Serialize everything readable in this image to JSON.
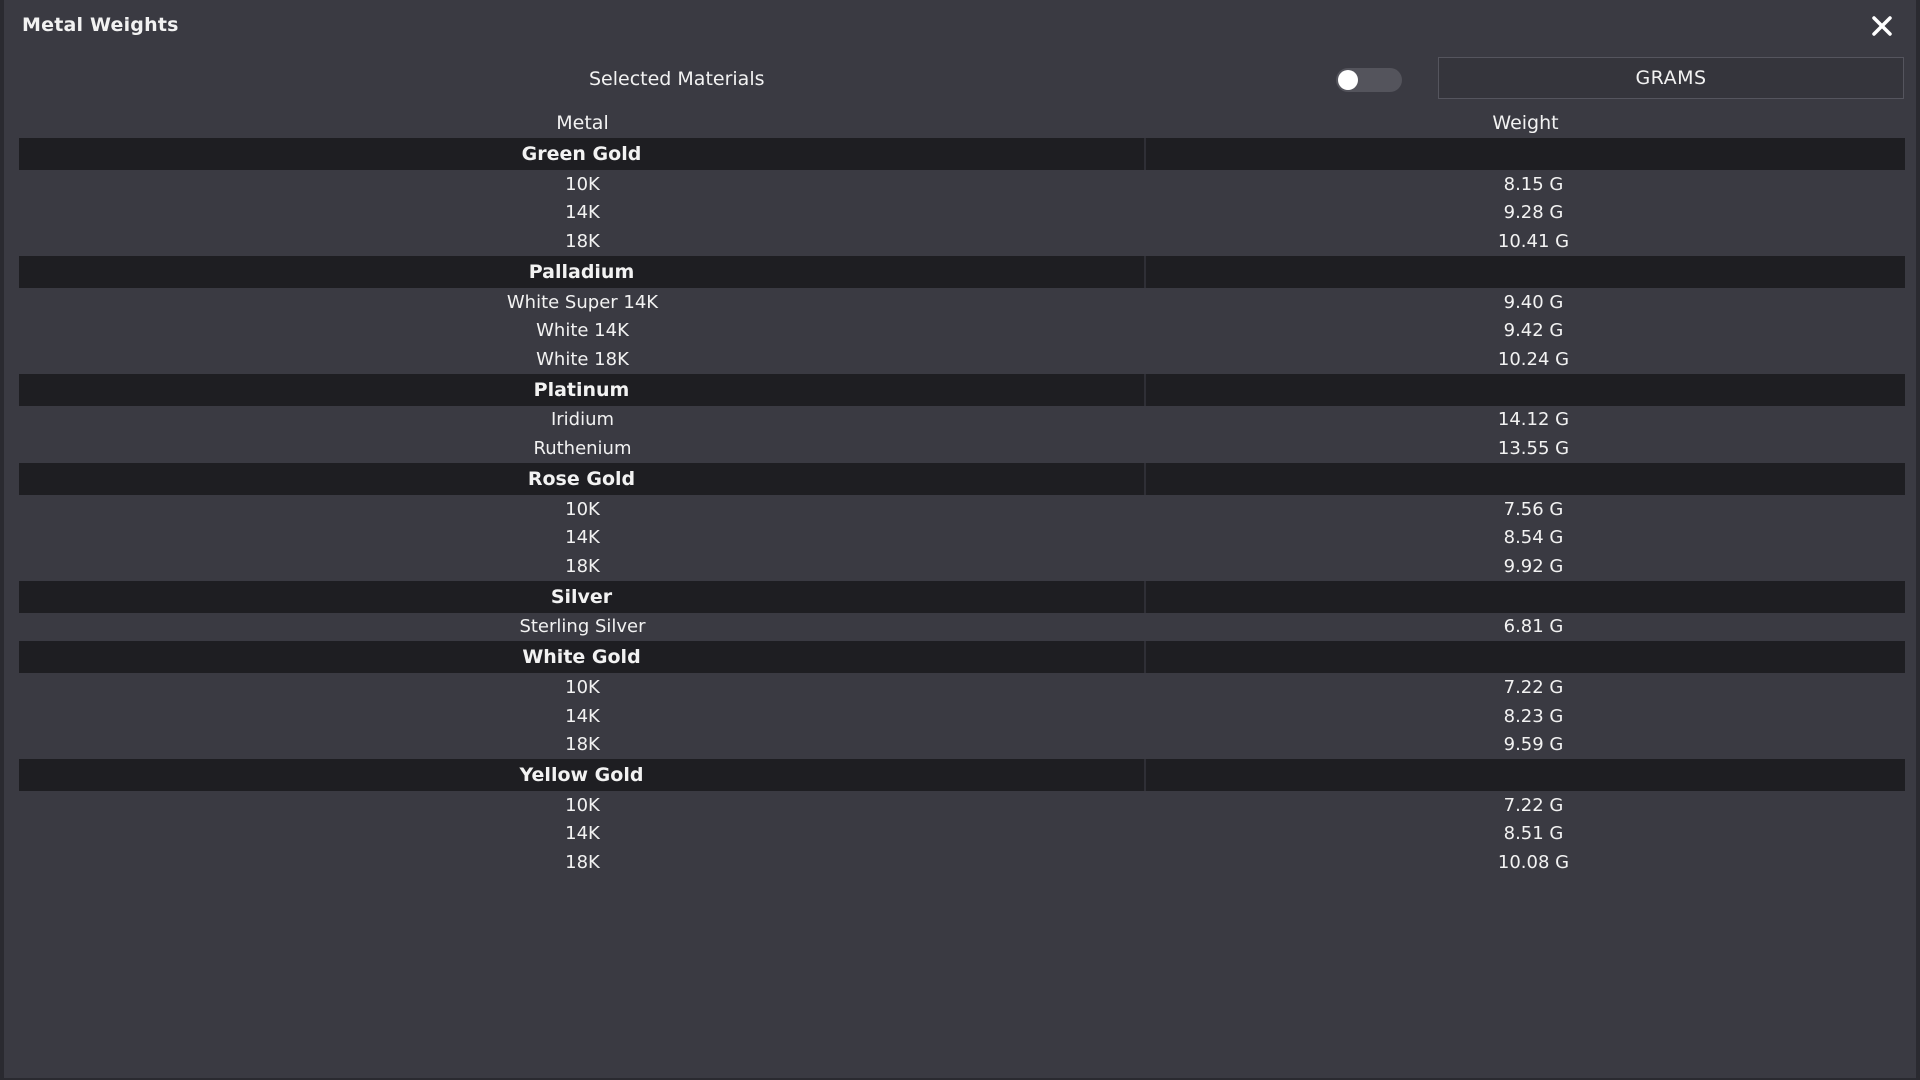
{
  "window": {
    "title": "Metal Weights"
  },
  "toolbar": {
    "selected_label": "Selected Materials",
    "units_label": "GRAMS"
  },
  "table": {
    "headers": [
      "Metal",
      "Weight"
    ],
    "groups": [
      {
        "name": "Green Gold",
        "items": [
          {
            "metal": "10K",
            "weight": "8.15 G"
          },
          {
            "metal": "14K",
            "weight": "9.28 G"
          },
          {
            "metal": "18K",
            "weight": "10.41 G"
          }
        ]
      },
      {
        "name": "Palladium",
        "items": [
          {
            "metal": "White Super 14K",
            "weight": "9.40 G"
          },
          {
            "metal": "White 14K",
            "weight": "9.42 G"
          },
          {
            "metal": "White 18K",
            "weight": "10.24 G"
          }
        ]
      },
      {
        "name": "Platinum",
        "items": [
          {
            "metal": "Iridium",
            "weight": "14.12 G"
          },
          {
            "metal": "Ruthenium",
            "weight": "13.55 G"
          }
        ]
      },
      {
        "name": "Rose Gold",
        "items": [
          {
            "metal": "10K",
            "weight": "7.56 G"
          },
          {
            "metal": "14K",
            "weight": "8.54 G"
          },
          {
            "metal": "18K",
            "weight": "9.92 G"
          }
        ]
      },
      {
        "name": "Silver",
        "items": [
          {
            "metal": "Sterling Silver",
            "weight": "6.81 G"
          }
        ]
      },
      {
        "name": "White Gold",
        "items": [
          {
            "metal": "10K",
            "weight": "7.22 G"
          },
          {
            "metal": "14K",
            "weight": "8.23 G"
          },
          {
            "metal": "18K",
            "weight": "9.59 G"
          }
        ]
      },
      {
        "name": "Yellow Gold",
        "items": [
          {
            "metal": "10K",
            "weight": "7.22 G"
          },
          {
            "metal": "14K",
            "weight": "8.51 G"
          },
          {
            "metal": "18K",
            "weight": "10.08 G"
          }
        ]
      }
    ]
  },
  "icons": {
    "close": "close-icon",
    "toggle": "toggle-switch"
  },
  "colors": {
    "background": "#3a3a42",
    "group_row": "#1e1e22",
    "text": "#f2f2f2"
  }
}
